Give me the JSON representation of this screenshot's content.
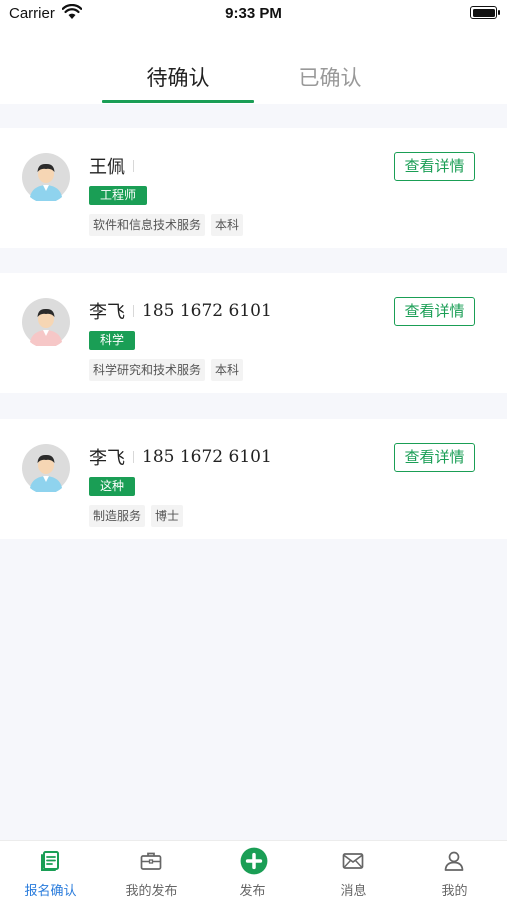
{
  "status_bar": {
    "carrier": "Carrier",
    "time": "9:33 PM"
  },
  "tabs": [
    {
      "label": "待确认",
      "active": true
    },
    {
      "label": "已确认",
      "active": false
    }
  ],
  "cards": [
    {
      "name": "王佩",
      "phone": "",
      "tag": "工程师",
      "chips": [
        "软件和信息技术服务",
        "本科"
      ],
      "button": "查看详情",
      "avatar": "male-avatar-icon"
    },
    {
      "name": "李飞",
      "phone": "185 1672 6101",
      "tag": "科学",
      "chips": [
        "科学研究和技术服务",
        "本科"
      ],
      "button": "查看详情",
      "avatar": "female-avatar-icon"
    },
    {
      "name": "李飞",
      "phone": "185 1672 6101",
      "tag": "这种",
      "chips": [
        "制造服务",
        "博士"
      ],
      "button": "查看详情",
      "avatar": "male-avatar-icon"
    }
  ],
  "bottom_nav": [
    {
      "label": "报名确认",
      "icon": "document-icon",
      "active": true
    },
    {
      "label": "我的发布",
      "icon": "briefcase-icon",
      "active": false
    },
    {
      "label": "发布",
      "icon": "plus-circle-icon",
      "active": false
    },
    {
      "label": "消息",
      "icon": "mail-icon",
      "active": false
    },
    {
      "label": "我的",
      "icon": "person-icon",
      "active": false
    }
  ],
  "colors": {
    "accent": "#1a9e55",
    "nav_active": "#2a7cdc",
    "background": "#f6f7fb"
  }
}
